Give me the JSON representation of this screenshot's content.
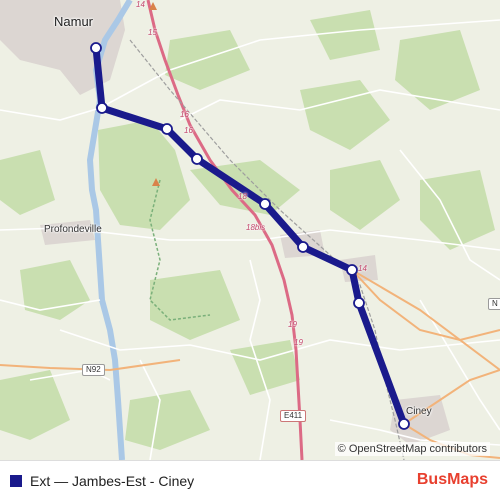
{
  "map": {
    "places": {
      "namur": "Namur",
      "profondeville": "Profondeville",
      "ciney": "Ciney"
    },
    "road_labels": {
      "r14_top": "14",
      "r15": "15",
      "r16a": "16",
      "r16b": "16",
      "r18a": "18",
      "r18bis": "18bis",
      "r14_mid": "14",
      "r19a": "19",
      "r19b": "19",
      "n92": "N92",
      "e411": "E411",
      "n_right": "N"
    },
    "attribution": "© OpenStreetMap contributors",
    "route": {
      "color": "#1a1a8c"
    }
  },
  "legend": {
    "label": "Ext — Jambes-Est - Ciney",
    "swatch_color": "#1a1a8c"
  },
  "brand": {
    "bus": "Bus",
    "maps": "Maps"
  }
}
